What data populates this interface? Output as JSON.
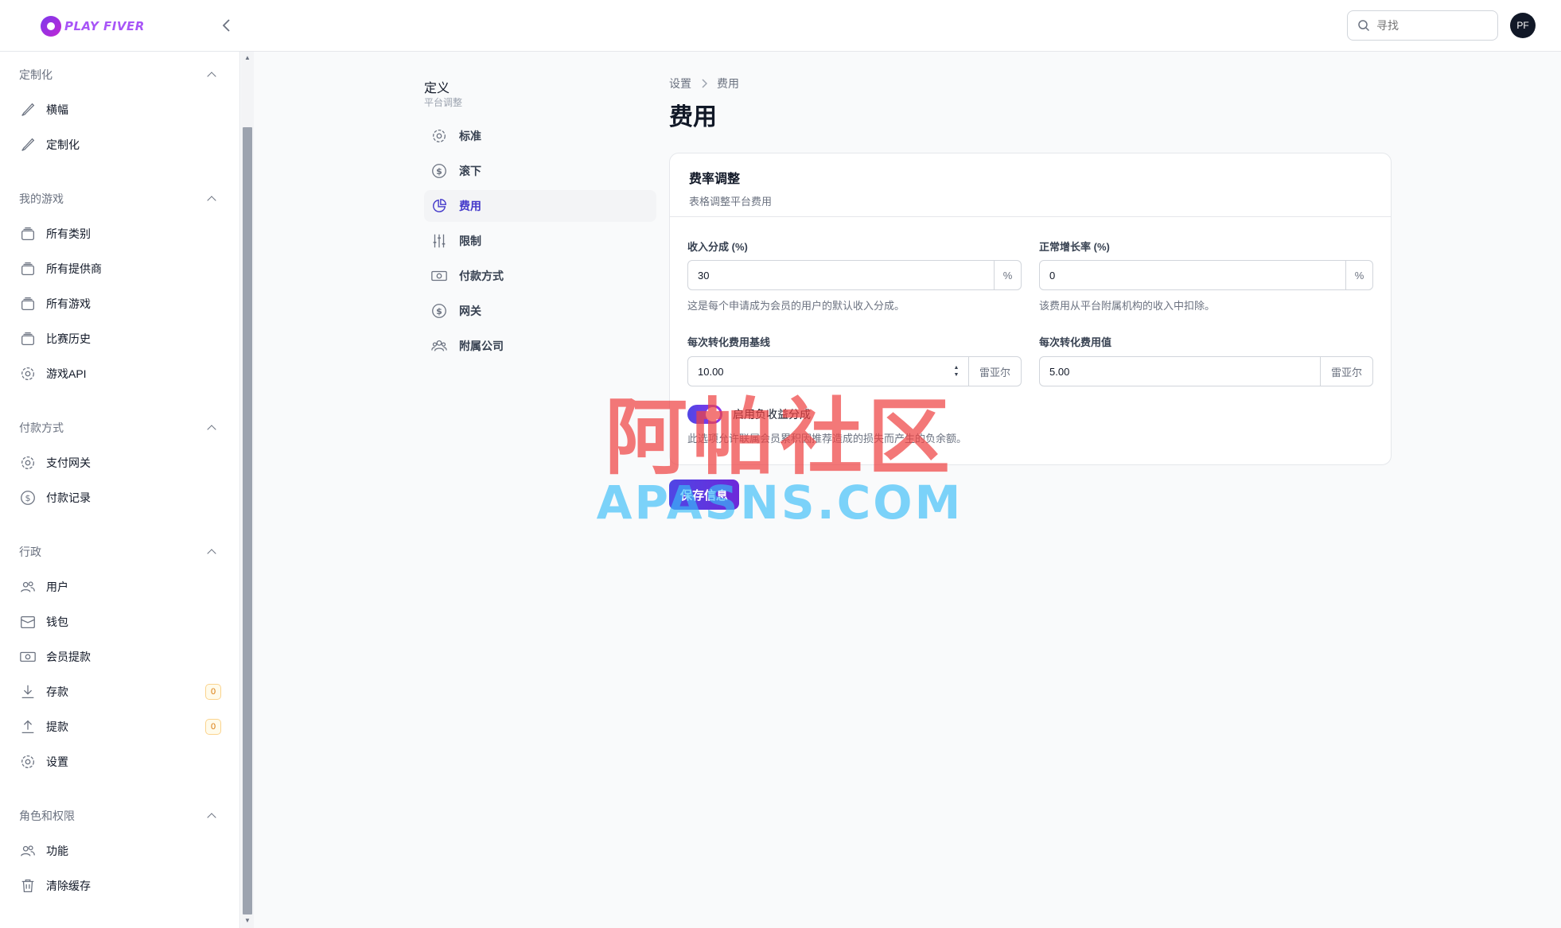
{
  "app": {
    "logo_text": "PLAY FIVER",
    "search_placeholder": "寻找",
    "avatar_initials": "PF"
  },
  "sidebar": {
    "sections": [
      {
        "title": "定制化",
        "items": [
          {
            "label": "横幅",
            "icon": "brush-icon"
          },
          {
            "label": "定制化",
            "icon": "brush-icon"
          }
        ]
      },
      {
        "title": "我的游戏",
        "items": [
          {
            "label": "所有类别",
            "icon": "stack-icon"
          },
          {
            "label": "所有提供商",
            "icon": "stack-icon"
          },
          {
            "label": "所有游戏",
            "icon": "stack-icon"
          },
          {
            "label": "比赛历史",
            "icon": "stack-icon"
          },
          {
            "label": "游戏API",
            "icon": "gear-icon"
          }
        ]
      },
      {
        "title": "付款方式",
        "items": [
          {
            "label": "支付网关",
            "icon": "gear-icon"
          },
          {
            "label": "付款记录",
            "icon": "dollar-icon"
          }
        ]
      },
      {
        "title": "行政",
        "items": [
          {
            "label": "用户",
            "icon": "users-icon"
          },
          {
            "label": "钱包",
            "icon": "wallet-icon"
          },
          {
            "label": "会员提款",
            "icon": "cash-icon"
          },
          {
            "label": "存款",
            "icon": "download-icon",
            "badge": "0"
          },
          {
            "label": "提款",
            "icon": "upload-icon",
            "badge": "0"
          },
          {
            "label": "设置",
            "icon": "gear-icon"
          }
        ]
      },
      {
        "title": "角色和权限",
        "items": [
          {
            "label": "功能",
            "icon": "users-icon"
          },
          {
            "label": "清除缓存",
            "icon": "trash-icon"
          }
        ]
      }
    ]
  },
  "settings_menu": {
    "title": "定义",
    "subtitle": "平台调整",
    "items": [
      {
        "label": "标准",
        "icon": "gear-icon"
      },
      {
        "label": "滚下",
        "icon": "dollar-icon"
      },
      {
        "label": "费用",
        "icon": "pie-chart-icon",
        "active": true
      },
      {
        "label": "限制",
        "icon": "sliders-icon"
      },
      {
        "label": "付款方式",
        "icon": "cash-icon"
      },
      {
        "label": "网关",
        "icon": "dollar-icon"
      },
      {
        "label": "附属公司",
        "icon": "users-icon"
      }
    ]
  },
  "main": {
    "breadcrumb": [
      "设置",
      "费用"
    ],
    "title": "费用",
    "card": {
      "title": "费率调整",
      "description": "表格调整平台费用",
      "fields": {
        "revenue_share": {
          "label": "收入分成 (%)",
          "value": "30",
          "addon": "%",
          "help": "这是每个申请成为会员的用户的默认收入分成。"
        },
        "normal_growth": {
          "label": "正常增长率 (%)",
          "value": "0",
          "addon": "%",
          "help": "该费用从平台附属机构的收入中扣除。"
        },
        "conversion_baseline": {
          "label": "每次转化费用基线",
          "value": "10.00",
          "addon": "雷亚尔"
        },
        "conversion_value": {
          "label": "每次转化费用值",
          "value": "5.00",
          "addon": "雷亚尔"
        }
      },
      "toggle": {
        "label": "启用负收益分成",
        "enabled": true,
        "help": "此选项允许联属会员累积因推荐造成的损失而产生的负余额。"
      }
    },
    "save_label": "保存信息"
  },
  "watermark": {
    "line1": "阿帕社区",
    "line2": "APASNS.COM"
  },
  "colors": {
    "accent": "#4f46e5",
    "toggle_end": "#9333ea",
    "badge": "#d97706"
  }
}
